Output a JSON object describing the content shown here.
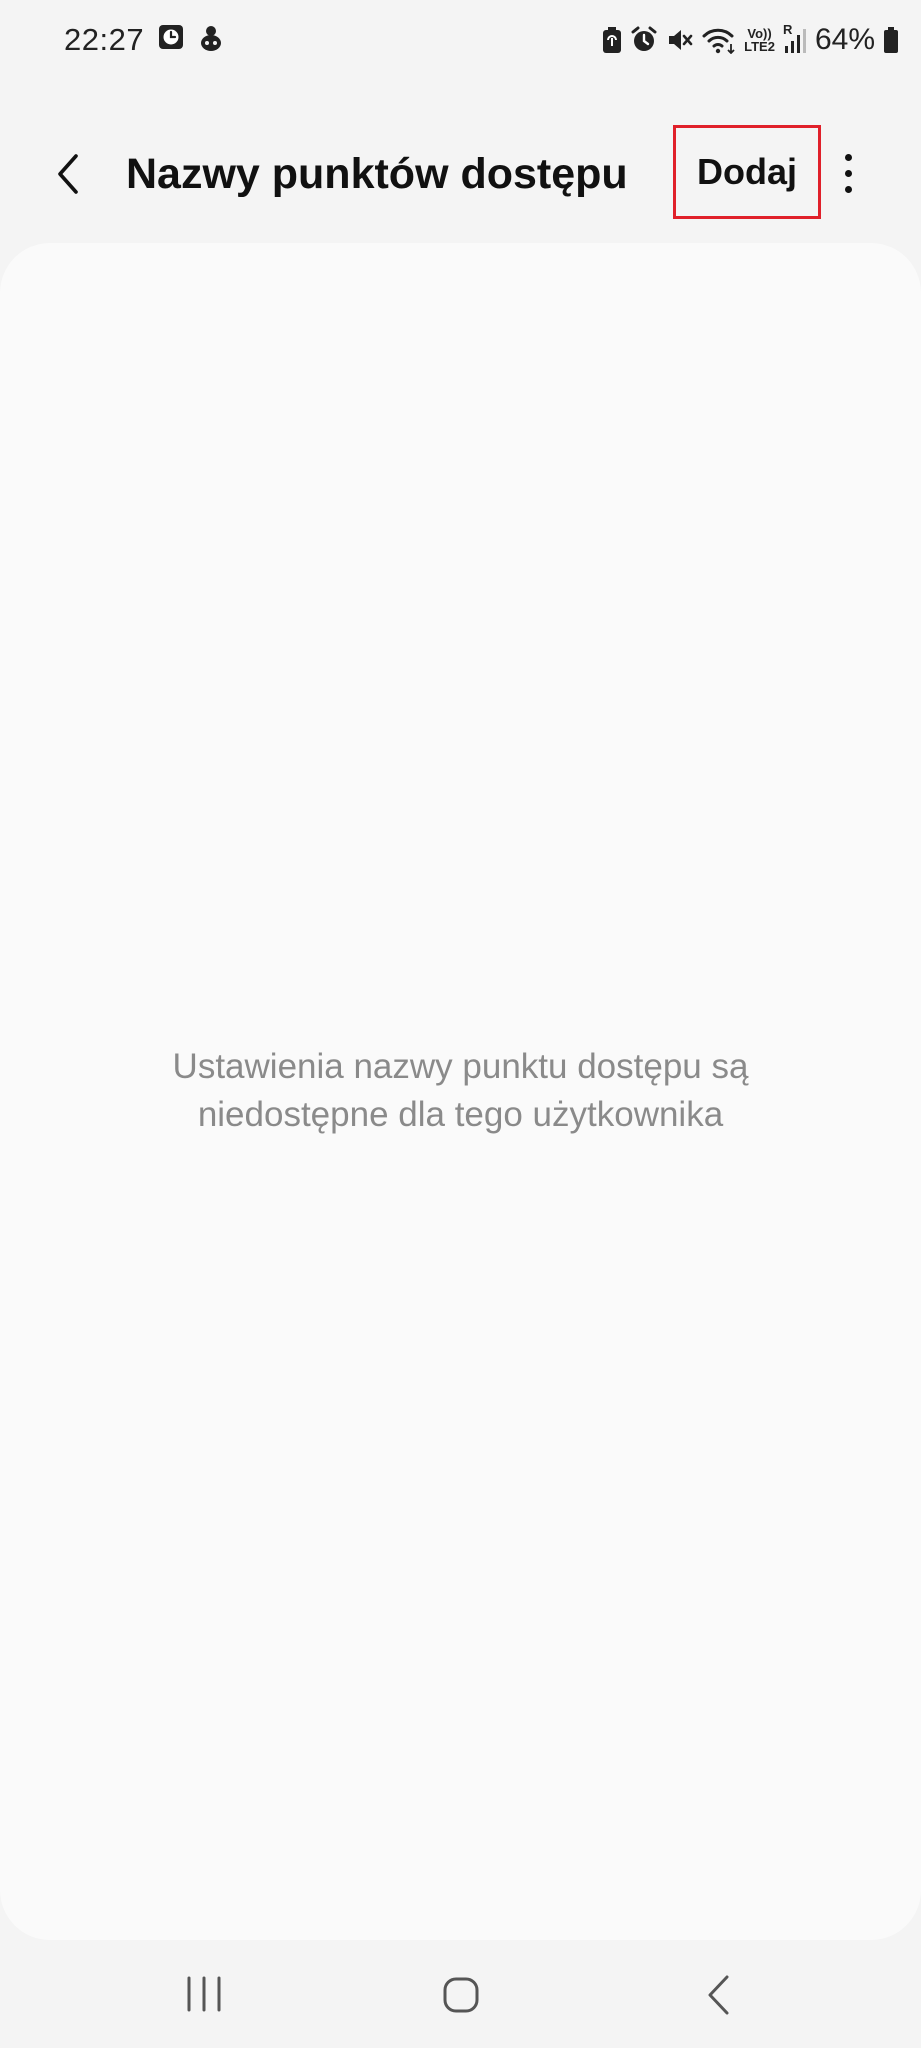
{
  "status_bar": {
    "time": "22:27",
    "left_icons": [
      "clock-app-icon",
      "notification-icon"
    ],
    "right_icons": [
      "battery-saver-icon",
      "alarm-icon",
      "mute-icon",
      "wifi-icon",
      "volte-icon",
      "signal-icon",
      "battery-icon"
    ],
    "volte_line1": "Vo))",
    "volte_line2": "LTE2",
    "roaming": "R",
    "battery_percent": "64%"
  },
  "app_bar": {
    "back_icon": "back-chevron-icon",
    "title": "Nazwy punktów dostępu",
    "add_label": "Dodaj",
    "more_icon": "more-vertical-icon",
    "highlight_color": "#e0202a"
  },
  "content": {
    "empty_message_line1": "Ustawienia nazwy punktu dostępu są",
    "empty_message_line2": "niedostępne dla tego użytkownika"
  },
  "nav_bar": {
    "recents_icon": "recents-icon",
    "home_icon": "home-icon",
    "back_icon": "back-icon"
  }
}
